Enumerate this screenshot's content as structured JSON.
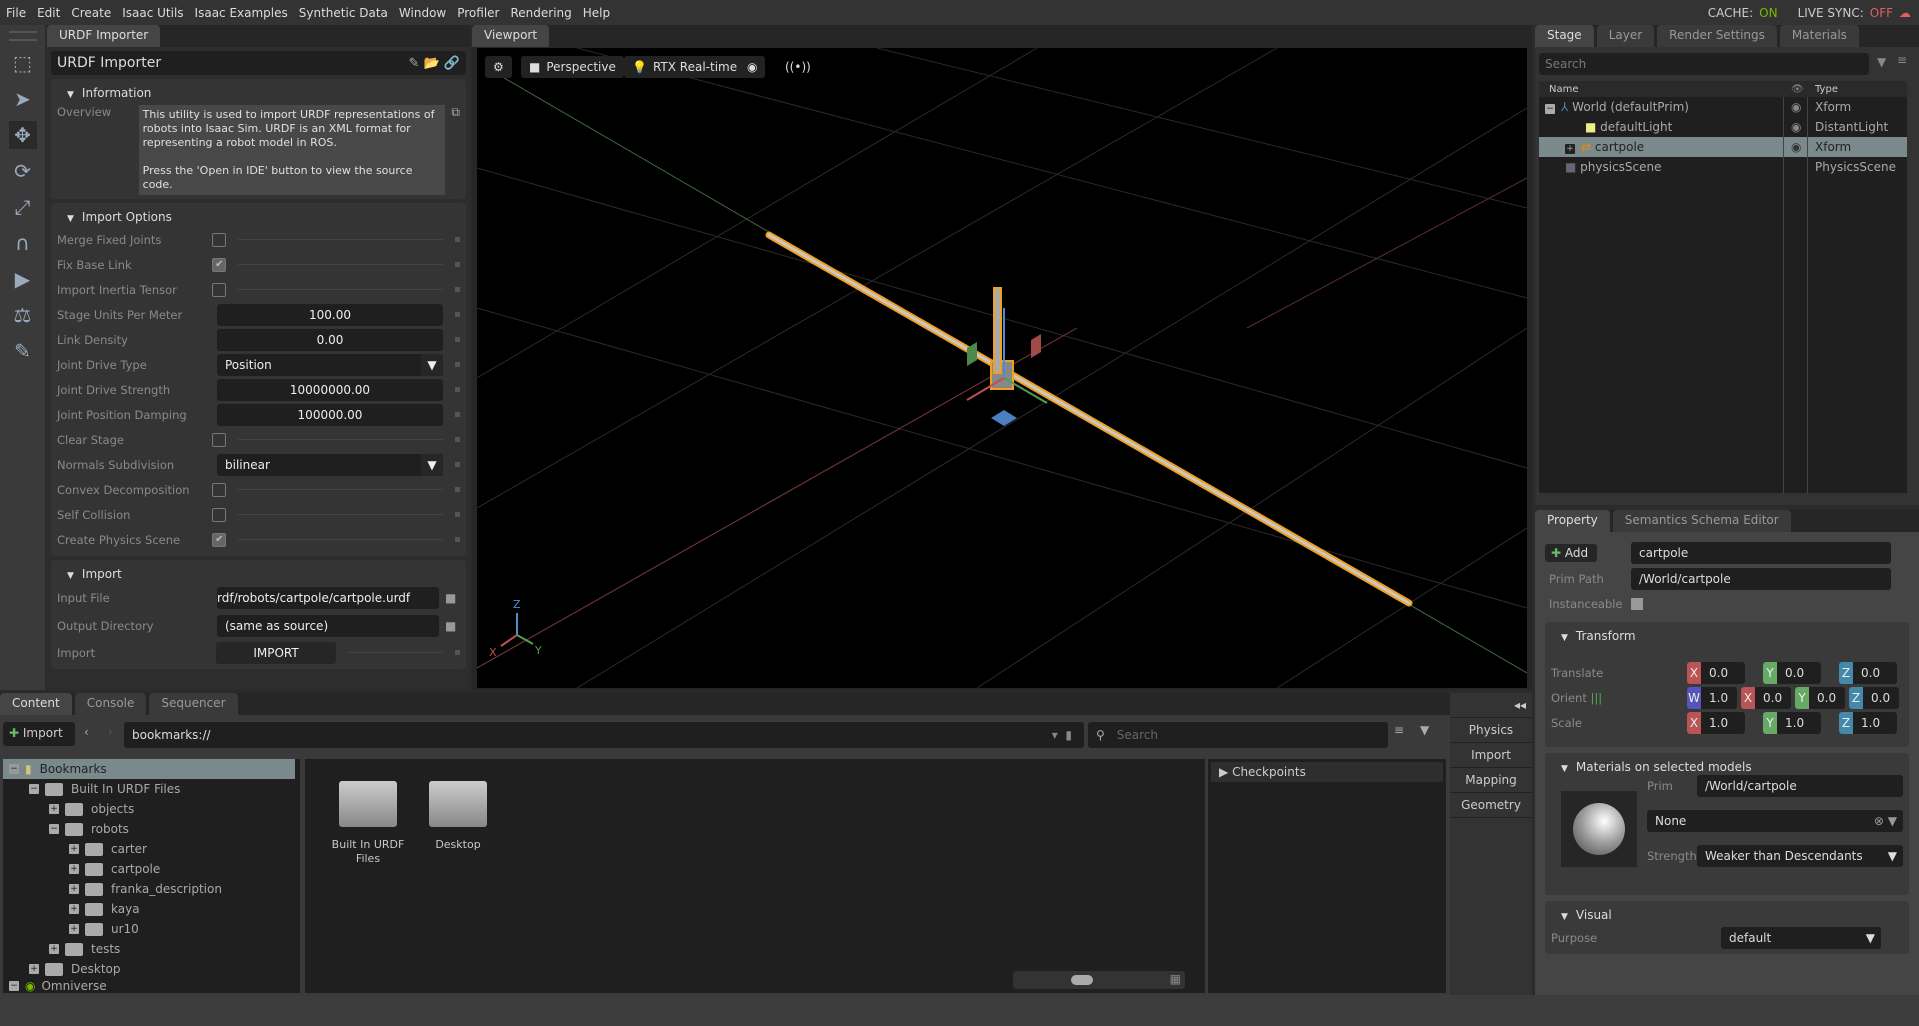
{
  "menu": [
    "File",
    "Edit",
    "Create",
    "Isaac Utils",
    "Isaac Examples",
    "Synthetic Data",
    "Window",
    "Profiler",
    "Rendering",
    "Help"
  ],
  "status": {
    "cache_label": "CACHE:",
    "cache_value": "ON",
    "live_label": "LIVE SYNC:",
    "live_value": "OFF",
    "on_color": "#76b900",
    "off_color": "#e06060"
  },
  "urdf": {
    "tab": "URDF Importer",
    "title": "URDF Importer",
    "info": {
      "header": "Information",
      "overview_label": "Overview",
      "overview_text1": "This utility is used to import URDF representations of robots into Isaac Sim. URDF is an XML format for representing a robot model in ROS.",
      "overview_text2": "Press the 'Open in IDE' button to view the source code."
    },
    "options": {
      "header": "Import Options",
      "merge": "Merge Fixed Joints",
      "fix": "Fix Base Link",
      "inertia": "Import Inertia Tensor",
      "units": "Stage Units Per Meter",
      "units_val": "100.00",
      "density": "Link Density",
      "density_val": "0.00",
      "drive_type": "Joint Drive Type",
      "drive_type_val": "Position",
      "drive_strength": "Joint Drive Strength",
      "drive_strength_val": "10000000.00",
      "damping": "Joint Position Damping",
      "damping_val": "100000.00",
      "clear": "Clear Stage",
      "normals": "Normals Subdivision",
      "normals_val": "bilinear",
      "convex": "Convex Decomposition",
      "self": "Self Collision",
      "physics": "Create Physics Scene"
    },
    "checks": {
      "merge": false,
      "fix": true,
      "inertia": false,
      "clear": false,
      "convex": false,
      "self": false,
      "physics": true
    },
    "import": {
      "header": "Import",
      "input_label": "Input File",
      "input_val": "rdf/robots/cartpole/cartpole.urdf",
      "output_label": "Output Directory",
      "output_val": "(same as source)",
      "import_label": "Import",
      "import_btn": "IMPORT"
    }
  },
  "viewport": {
    "tab": "Viewport",
    "camera": "Perspective",
    "render": "RTX Real-time",
    "axis_x": "X",
    "axis_y": "Y",
    "axis_z": "Z"
  },
  "stage": {
    "tabs": [
      "Stage",
      "Layer",
      "Render Settings",
      "Materials"
    ],
    "search": "Search",
    "col_name": "Name",
    "col_type": "Type",
    "rows": [
      {
        "name": "World (defaultPrim)",
        "type": "Xform"
      },
      {
        "name": "defaultLight",
        "type": "DistantLight"
      },
      {
        "name": "cartpole",
        "type": "Xform"
      },
      {
        "name": "physicsScene",
        "type": "PhysicsScene"
      }
    ]
  },
  "property": {
    "tabs": [
      "Property",
      "Semantics Schema Editor"
    ],
    "add": "Add",
    "name_val": "cartpole",
    "prim_path_label": "Prim Path",
    "prim_path_val": "/World/cartpole",
    "instanceable": "Instanceable",
    "transform": "Transform",
    "translate": "Translate",
    "orient": "Orient",
    "scale": "Scale",
    "t": [
      "0.0",
      "0.0",
      "0.0"
    ],
    "o": [
      "1.0",
      "0.0",
      "0.0",
      "0.0"
    ],
    "s": [
      "1.0",
      "1.0",
      "1.0"
    ],
    "materials": "Materials on selected models",
    "prim_label": "Prim",
    "prim_val": "/World/cartpole",
    "material_val": "None",
    "strength_label": "Strength",
    "strength_val": "Weaker than Descendants",
    "visual": "Visual",
    "purpose": "Purpose",
    "purpose_val": "default"
  },
  "content": {
    "tabs": [
      "Content",
      "Console",
      "Sequencer"
    ],
    "import": "Import",
    "path": "bookmarks://",
    "search": "Search",
    "checkpoints": "Checkpoints",
    "tree": [
      "Bookmarks",
      "Built In URDF Files",
      "objects",
      "robots",
      "carter",
      "cartpole",
      "franka_description",
      "kaya",
      "ur10",
      "tests",
      "Desktop",
      "Omniverse"
    ],
    "grid": [
      "Built In URDF Files",
      "Desktop"
    ]
  },
  "side_buttons": [
    "Physics",
    "Import",
    "Mapping",
    "Geometry"
  ]
}
